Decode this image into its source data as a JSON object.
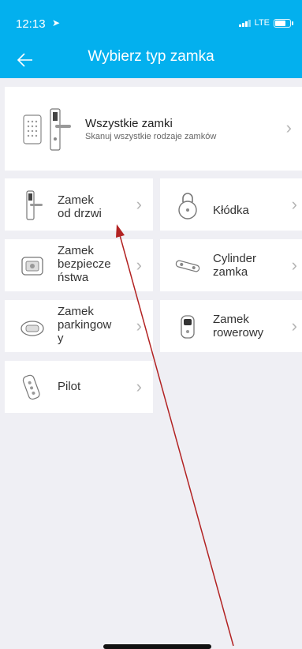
{
  "status": {
    "time": "12:13",
    "network": "LTE"
  },
  "header": {
    "title": "Wybierz typ zamka"
  },
  "all_locks": {
    "title": "Wszystkie zamki",
    "subtitle": "Skanuj wszystkie rodzaje zamków"
  },
  "tiles": [
    {
      "label": "Zamek\nod drzwi"
    },
    {
      "label": "Kłódka"
    },
    {
      "label": "Zamek\nbezpiecze\nństwa"
    },
    {
      "label": "Cylinder\nzamka"
    },
    {
      "label": "Zamek\nparkingow\ny"
    },
    {
      "label": "Zamek\nrowerowy"
    },
    {
      "label": "Pilot"
    }
  ],
  "colors": {
    "accent": "#03b0ee",
    "annotation_arrow": "#b22222"
  }
}
